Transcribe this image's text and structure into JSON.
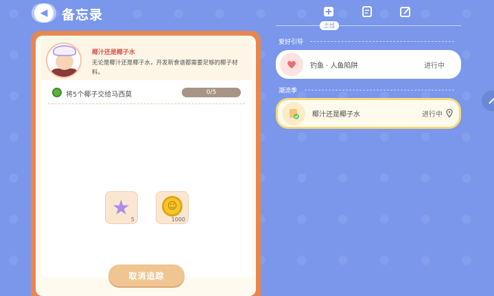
{
  "header": {
    "title": "备忘录",
    "back_icon": "back-arrow-icon"
  },
  "tabs": {
    "items": [
      {
        "icon": "main-quest-icon"
      },
      {
        "icon": "document-icon"
      },
      {
        "icon": "edit-icon"
      }
    ],
    "active_label": "主线"
  },
  "quest": {
    "title": "椰汁还是椰子水",
    "description": "无论是椰汁还是椰子水，开发新食谱都需要足够的椰子材料。",
    "task": {
      "icon": "coconut-icon",
      "text": "将5个椰子交给马西莫",
      "progress": "0/5",
      "progress_fraction": 0
    },
    "rewards": [
      {
        "icon": "star-icon",
        "count": "5"
      },
      {
        "icon": "coin-icon",
        "count": "1000"
      }
    ],
    "cancel_label": "取消追踪"
  },
  "sidebar": {
    "sections": [
      {
        "label": "爱好引导",
        "items": [
          {
            "name": "钓鱼 · 人鱼陷阱",
            "status": "进行中",
            "icon": "heart-icon",
            "tracked": false
          }
        ]
      },
      {
        "label": "潮流季",
        "items": [
          {
            "name": "椰汁还是椰子水",
            "status": "进行中",
            "icon": "note-check-icon",
            "tracked": true
          }
        ]
      }
    ]
  },
  "colors": {
    "background": "#7a97eb",
    "card_frame": "#e8864f",
    "accent_red": "#e0524e",
    "button": "#f0c592",
    "active_border": "#f7d97a"
  }
}
